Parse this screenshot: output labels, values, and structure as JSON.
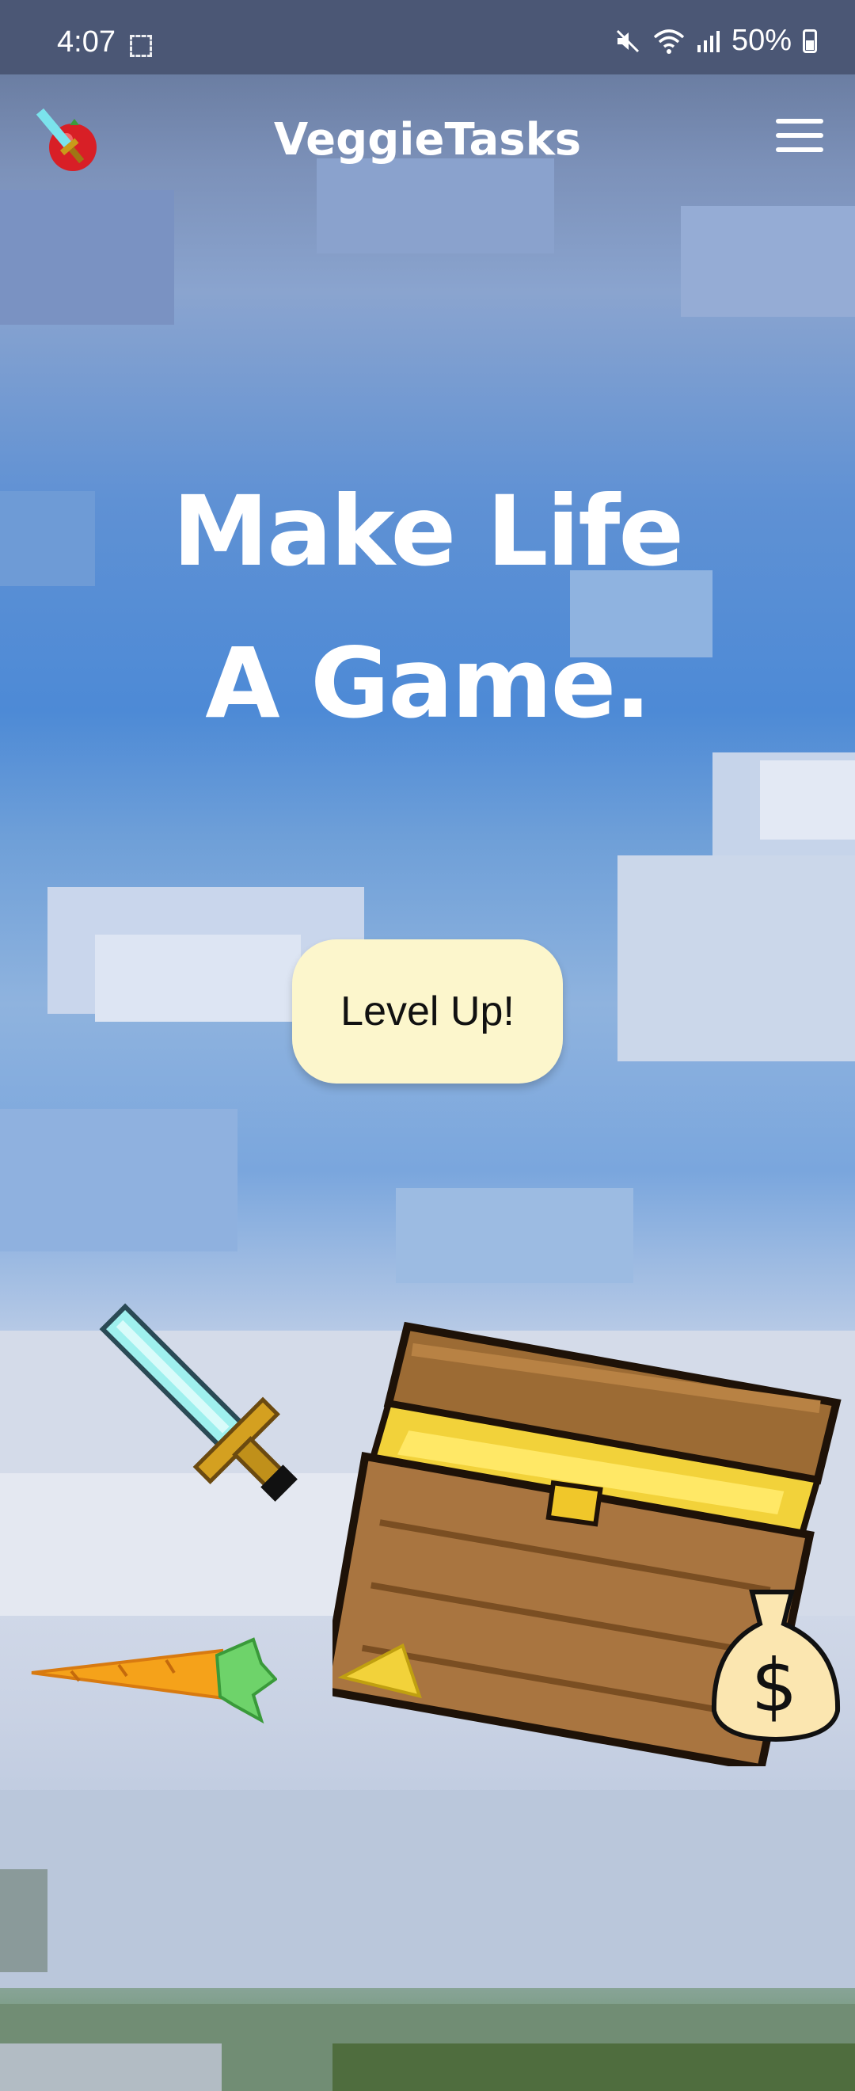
{
  "status_bar": {
    "time": "4:07",
    "battery": "50%",
    "icons": [
      "screenshot-icon",
      "mute-icon",
      "wifi-icon",
      "signal-icon",
      "battery-icon"
    ]
  },
  "header": {
    "app_title": "VeggieTasks",
    "logo_icon": "tomato-sword-logo",
    "menu_icon": "hamburger-menu-icon"
  },
  "hero": {
    "line1": "Make Life",
    "line2": "A Game."
  },
  "cta": {
    "label": "Level Up!"
  },
  "colors": {
    "status_bar": "#4b5775",
    "sky": "#4d8ad6",
    "button_bg": "#fcf6cc",
    "text": "#ffffff"
  },
  "illustrations": [
    "diamond-sword-icon",
    "carrot-icon",
    "treasure-chest-icon",
    "money-bag-icon"
  ]
}
